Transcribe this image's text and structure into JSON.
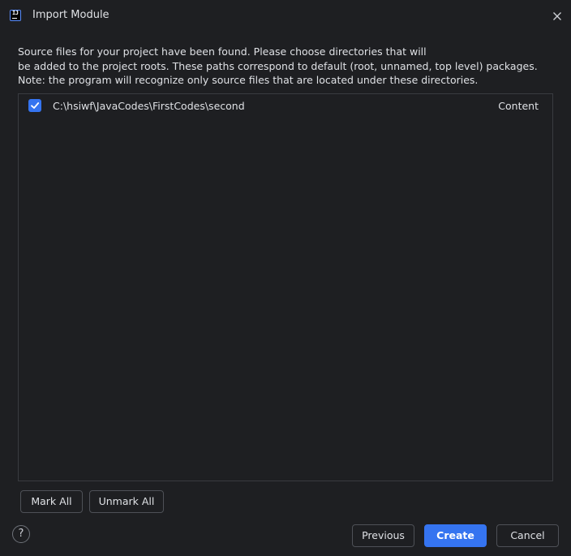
{
  "window": {
    "title": "Import Module",
    "app_icon_text": "IJ"
  },
  "description": {
    "line1": "Source files for your project have been found. Please choose directories that will",
    "line2": "be added to the project roots. These paths correspond to default (root, unnamed, top level) packages.",
    "line3": "Note: the program will recognize only source files that are located under these directories."
  },
  "roots": [
    {
      "checked": true,
      "path": "C:\\hsiwf\\JavaCodes\\FirstCodes\\second",
      "type": "Content"
    }
  ],
  "buttons": {
    "mark_all": "Mark All",
    "unmark_all": "Unmark All",
    "previous": "Previous",
    "create": "Create",
    "cancel": "Cancel",
    "help": "?"
  },
  "colors": {
    "background": "#1e1f22",
    "accent": "#3574f0",
    "text": "#dfe1e5",
    "border": "#4e5157"
  },
  "icons": {
    "app": "intellij-idea-icon",
    "close": "close-icon",
    "check": "checkmark-icon",
    "help": "help-icon"
  }
}
